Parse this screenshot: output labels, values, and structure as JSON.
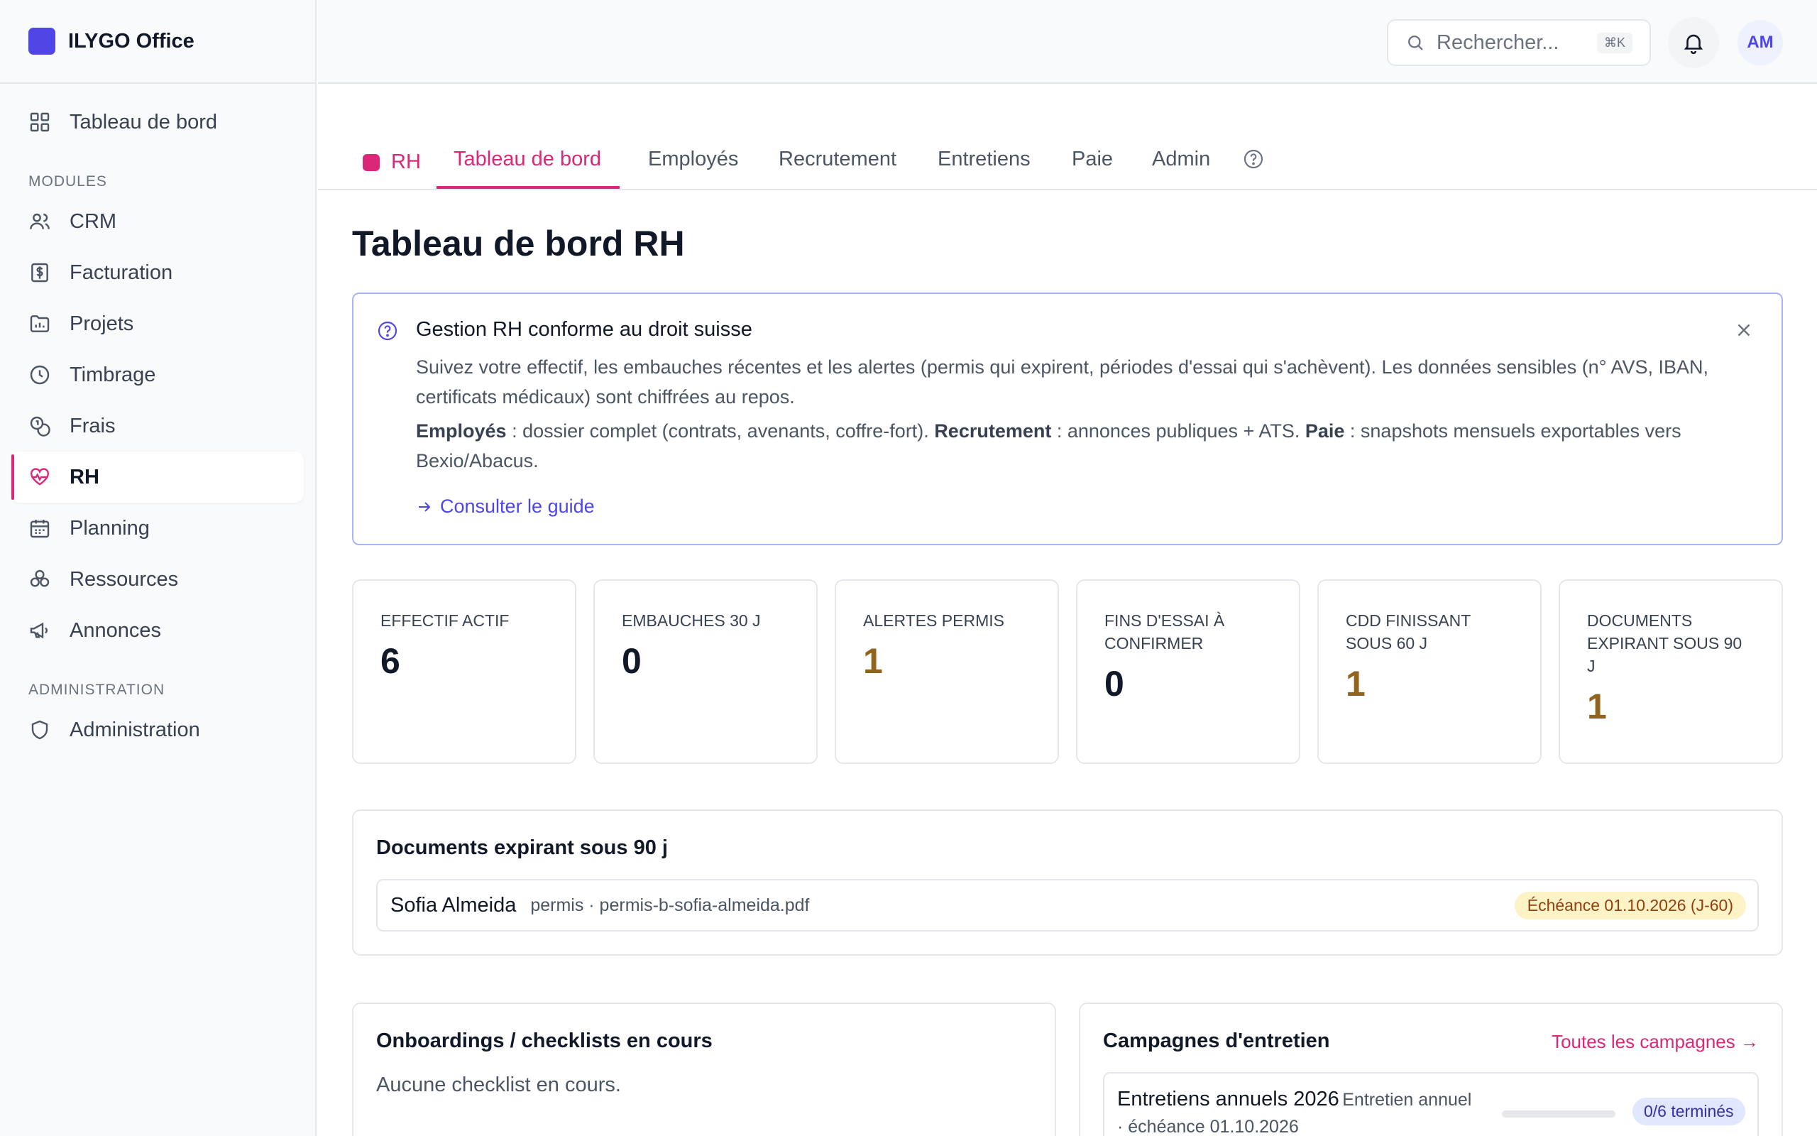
{
  "app": {
    "name": "ILYGO Office"
  },
  "sidebar": {
    "top_item": {
      "label": "Tableau de bord",
      "icon": "grid-icon"
    },
    "modules_heading": "MODULES",
    "modules": [
      {
        "label": "CRM",
        "icon": "users-icon"
      },
      {
        "label": "Facturation",
        "icon": "invoice-icon"
      },
      {
        "label": "Projets",
        "icon": "folder-chart-icon"
      },
      {
        "label": "Timbrage",
        "icon": "clock-icon"
      },
      {
        "label": "Frais",
        "icon": "coins-icon"
      },
      {
        "label": "RH",
        "icon": "heart-pulse-icon",
        "active": true
      },
      {
        "label": "Planning",
        "icon": "calendar-icon"
      },
      {
        "label": "Ressources",
        "icon": "boxes-icon"
      },
      {
        "label": "Annonces",
        "icon": "megaphone-icon"
      }
    ],
    "admin_heading": "ADMINISTRATION",
    "admin_items": [
      {
        "label": "Administration",
        "icon": "shield-icon"
      }
    ]
  },
  "header": {
    "search_placeholder": "Rechercher...",
    "search_shortcut": "⌘K",
    "avatar_initials": "AM"
  },
  "tabs": {
    "module_label": "RH",
    "items": [
      {
        "label": "Tableau de bord",
        "active": true
      },
      {
        "label": "Employés"
      },
      {
        "label": "Recrutement"
      },
      {
        "label": "Entretiens"
      },
      {
        "label": "Paie"
      },
      {
        "label": "Admin"
      }
    ]
  },
  "main": {
    "title": "Tableau de bord RH",
    "info": {
      "title": "Gestion RH conforme au droit suisse",
      "paragraph1": "Suivez votre effectif, les embauches récentes et les alertes (permis qui expirent, périodes d'essai qui s'achèvent). Les données sensibles (n° AVS, IBAN, certificats médicaux) sont chiffrées au repos.",
      "p2_employes_label": "Employés",
      "p2_employes_text": " : dossier complet (contrats, avenants, coffre-fort). ",
      "p2_recrutement_label": "Recrutement",
      "p2_recrutement_text": " : annonces publiques + ATS. ",
      "p2_paie_label": "Paie",
      "p2_paie_text": " : snapshots mensuels exportables vers Bexio/Abacus.",
      "guide_link": "Consulter le guide"
    },
    "stats": [
      {
        "label": "EFFECTIF ACTIF",
        "value": "6",
        "warn": false
      },
      {
        "label": "EMBAUCHES 30 J",
        "value": "0",
        "warn": false
      },
      {
        "label": "ALERTES PERMIS",
        "value": "1",
        "warn": true
      },
      {
        "label": "FINS D'ESSAI À CONFIRMER",
        "value": "0",
        "warn": false
      },
      {
        "label": "CDD FINISSANT SOUS 60 J",
        "value": "1",
        "warn": true
      },
      {
        "label": "DOCUMENTS EXPIRANT SOUS 90 J",
        "value": "1",
        "warn": true
      }
    ],
    "documents_panel": {
      "title": "Documents expirant sous 90 j",
      "rows": [
        {
          "name": "Sofia Almeida",
          "meta": "permis · permis-b-sofia-almeida.pdf",
          "badge": "Échéance 01.10.2026 (J-60)"
        }
      ]
    },
    "onboarding_panel": {
      "title": "Onboardings / checklists en cours",
      "empty_text": "Aucune checklist en cours."
    },
    "campaigns_panel": {
      "title": "Campagnes d'entretien",
      "link": "Toutes les campagnes →",
      "rows": [
        {
          "name": "Entretiens annuels 2026",
          "meta": "Entretien annuel · échéance 01.10.2026",
          "badge": "0/6 terminés",
          "progress": 0
        }
      ]
    }
  },
  "colors": {
    "accent": "#db2777",
    "brand": "#4f46e5",
    "warn": "#92631c"
  }
}
